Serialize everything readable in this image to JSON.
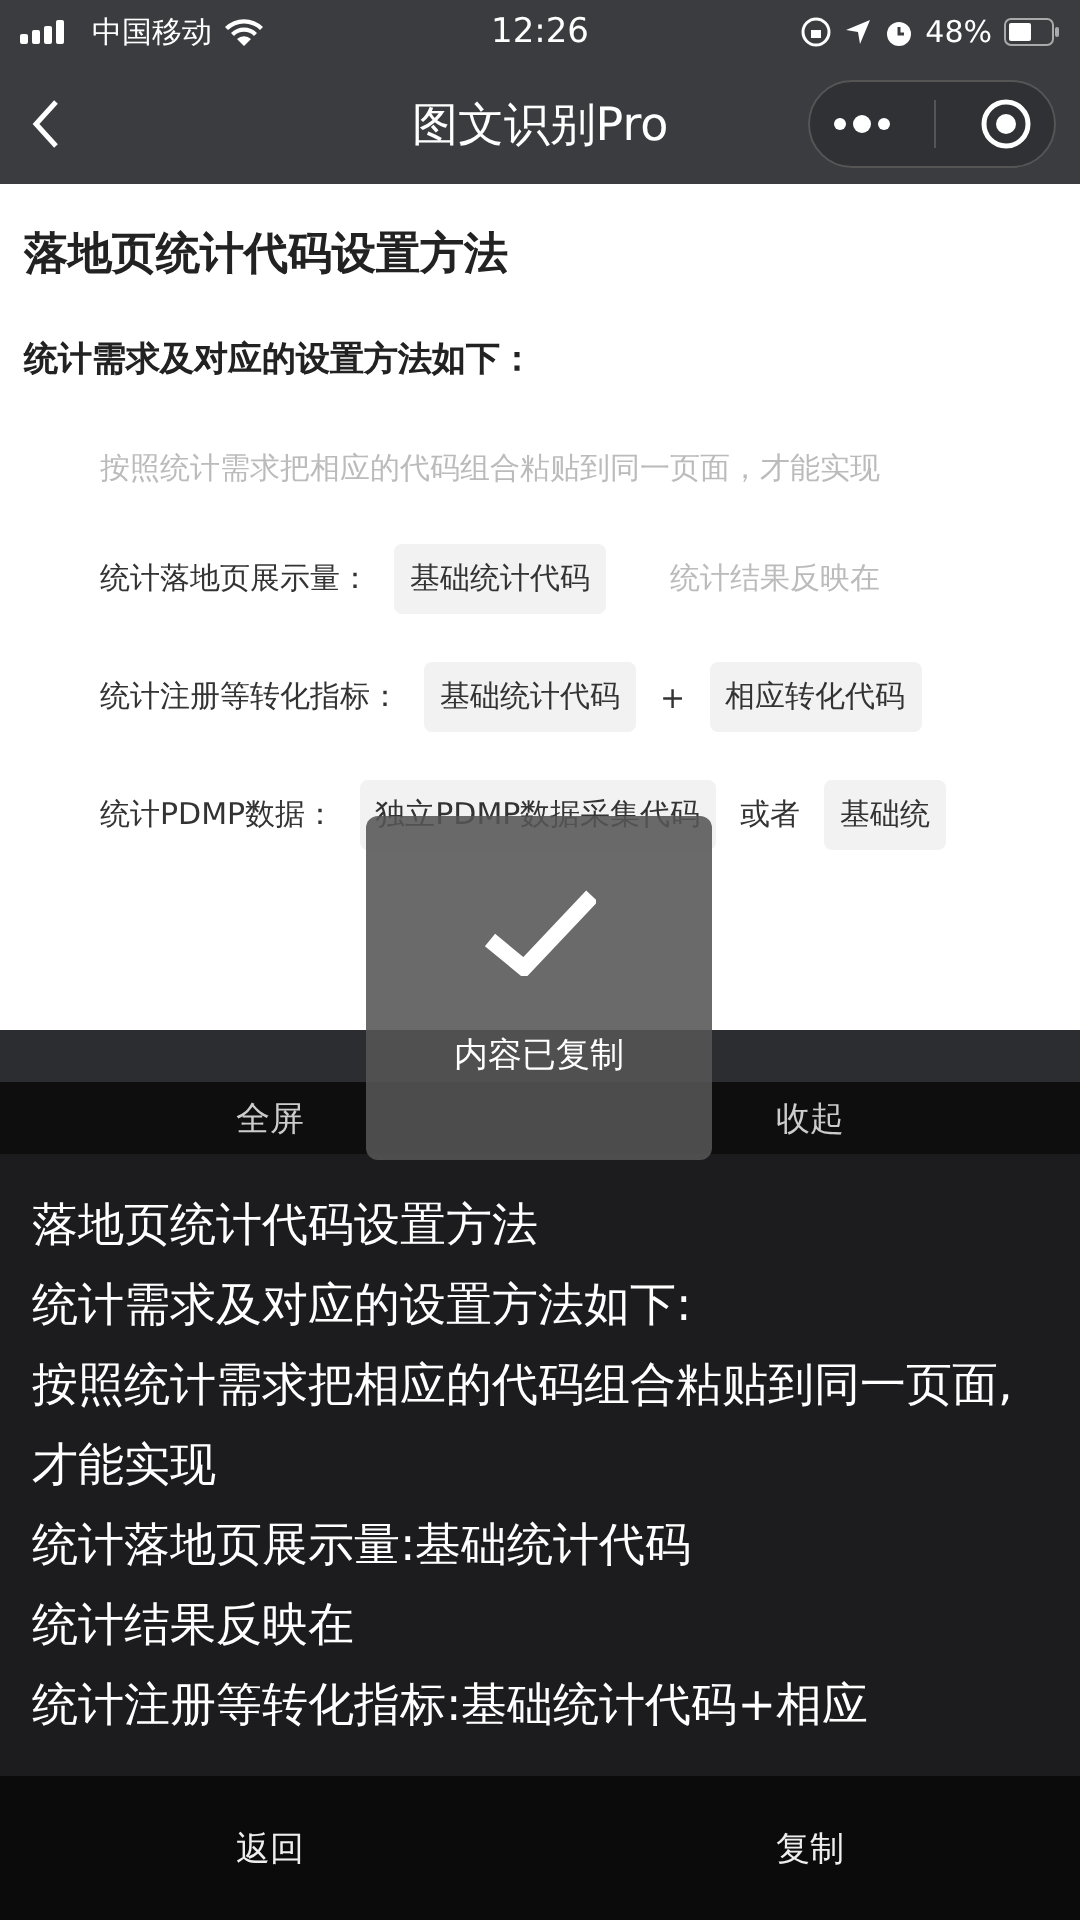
{
  "status_bar": {
    "carrier": "中国移动",
    "time": "12:26",
    "battery": "48%"
  },
  "nav": {
    "title": "图文识别Pro"
  },
  "document": {
    "title": "落地页统计代码设置方法",
    "subtitle": "统计需求及对应的设置方法如下：",
    "note": "按照统计需求把相应的代码组合粘贴到同一页面，才能实现",
    "rows": [
      {
        "label": "统计落地页展示量：",
        "parts": [
          {
            "kind": "tag",
            "text": "基础统计代码"
          },
          {
            "kind": "note",
            "text": "统计结果反映在"
          }
        ]
      },
      {
        "label": "统计注册等转化指标：",
        "parts": [
          {
            "kind": "tag",
            "text": "基础统计代码"
          },
          {
            "kind": "op",
            "text": "+"
          },
          {
            "kind": "tag",
            "text": "相应转化代码"
          }
        ]
      },
      {
        "label": "统计PDMP数据：",
        "parts": [
          {
            "kind": "tag",
            "text": "独立PDMP数据采集代码"
          },
          {
            "kind": "op",
            "text": "或者"
          },
          {
            "kind": "tag",
            "text": "基础统"
          }
        ]
      }
    ]
  },
  "panel_actions": [
    "全屏",
    "收起"
  ],
  "result_lines": [
    "落地页统计代码设置方法",
    "统计需求及对应的设置方法如下:",
    "按照统计需求把相应的代码组合粘贴到同一页面,才能实现",
    "统计落地页展示量:基础统计代码",
    "统计结果反映在",
    "统计注册等转化指标:基础统计代码+相应"
  ],
  "toast": {
    "text": "内容已复制"
  },
  "bottom_actions": [
    "返回",
    "复制"
  ]
}
